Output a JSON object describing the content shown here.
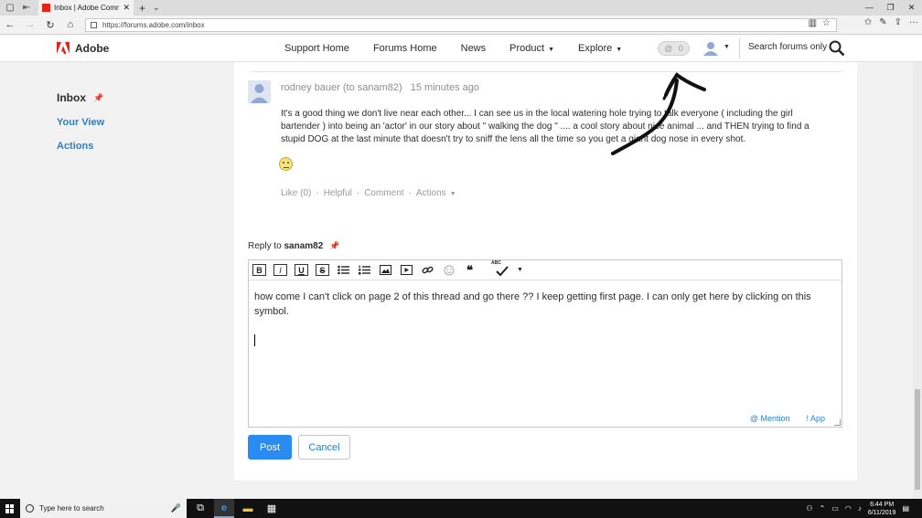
{
  "browser": {
    "tab_title": "Inbox | Adobe Commun",
    "url": "https://forums.adobe.com/inbox"
  },
  "header": {
    "brand": "Adobe",
    "nav": [
      {
        "label": "Support Home",
        "caret": false
      },
      {
        "label": "Forums Home",
        "caret": false
      },
      {
        "label": "News",
        "caret": false
      },
      {
        "label": "Product",
        "caret": true
      },
      {
        "label": "Explore",
        "caret": true
      }
    ],
    "notification_symbol": "@",
    "notification_count": "0",
    "search_placeholder": "Search forums only"
  },
  "sidebar": {
    "title": "Inbox",
    "links": [
      "Your View",
      "Actions"
    ]
  },
  "post": {
    "author": "rodney bauer",
    "recipient": "(to sanam82)",
    "time": "15 minutes ago",
    "body": "It's a good thing we don't live near each other... I can see us in the local watering hole trying to talk everyone ( including the girl bartender ) into being an 'actor' in our story about \" walking the dog \" .... a cool story about nice animal ... and THEN trying to find a stupid DOG at the last minute that doesn't try to sniff the lens all the time so you get a giant dog nose in every shot.",
    "actions": {
      "like": "Like (0)",
      "helpful": "Helpful",
      "comment": "Comment",
      "more": "Actions"
    }
  },
  "reply": {
    "label": "Reply to",
    "to": "sanam82",
    "text": "how come I can't click on page 2 of this thread and go there ?? I keep getting first page. I can only get here by clicking on this symbol.",
    "mention": "@ Mention",
    "app": "! App",
    "post_label": "Post",
    "cancel_label": "Cancel"
  },
  "toolbar": {
    "bold": "B",
    "italic": "I",
    "underline": "U",
    "strike": "S",
    "quote": "❝",
    "spell": "ABC"
  },
  "taskbar": {
    "search_placeholder": "Type here to search",
    "time": "6:44 PM",
    "date": "6/11/2019"
  },
  "colors": {
    "link": "#2d7fc1",
    "primary_button": "#2a8bf0",
    "adobe_red": "#e1251b"
  }
}
